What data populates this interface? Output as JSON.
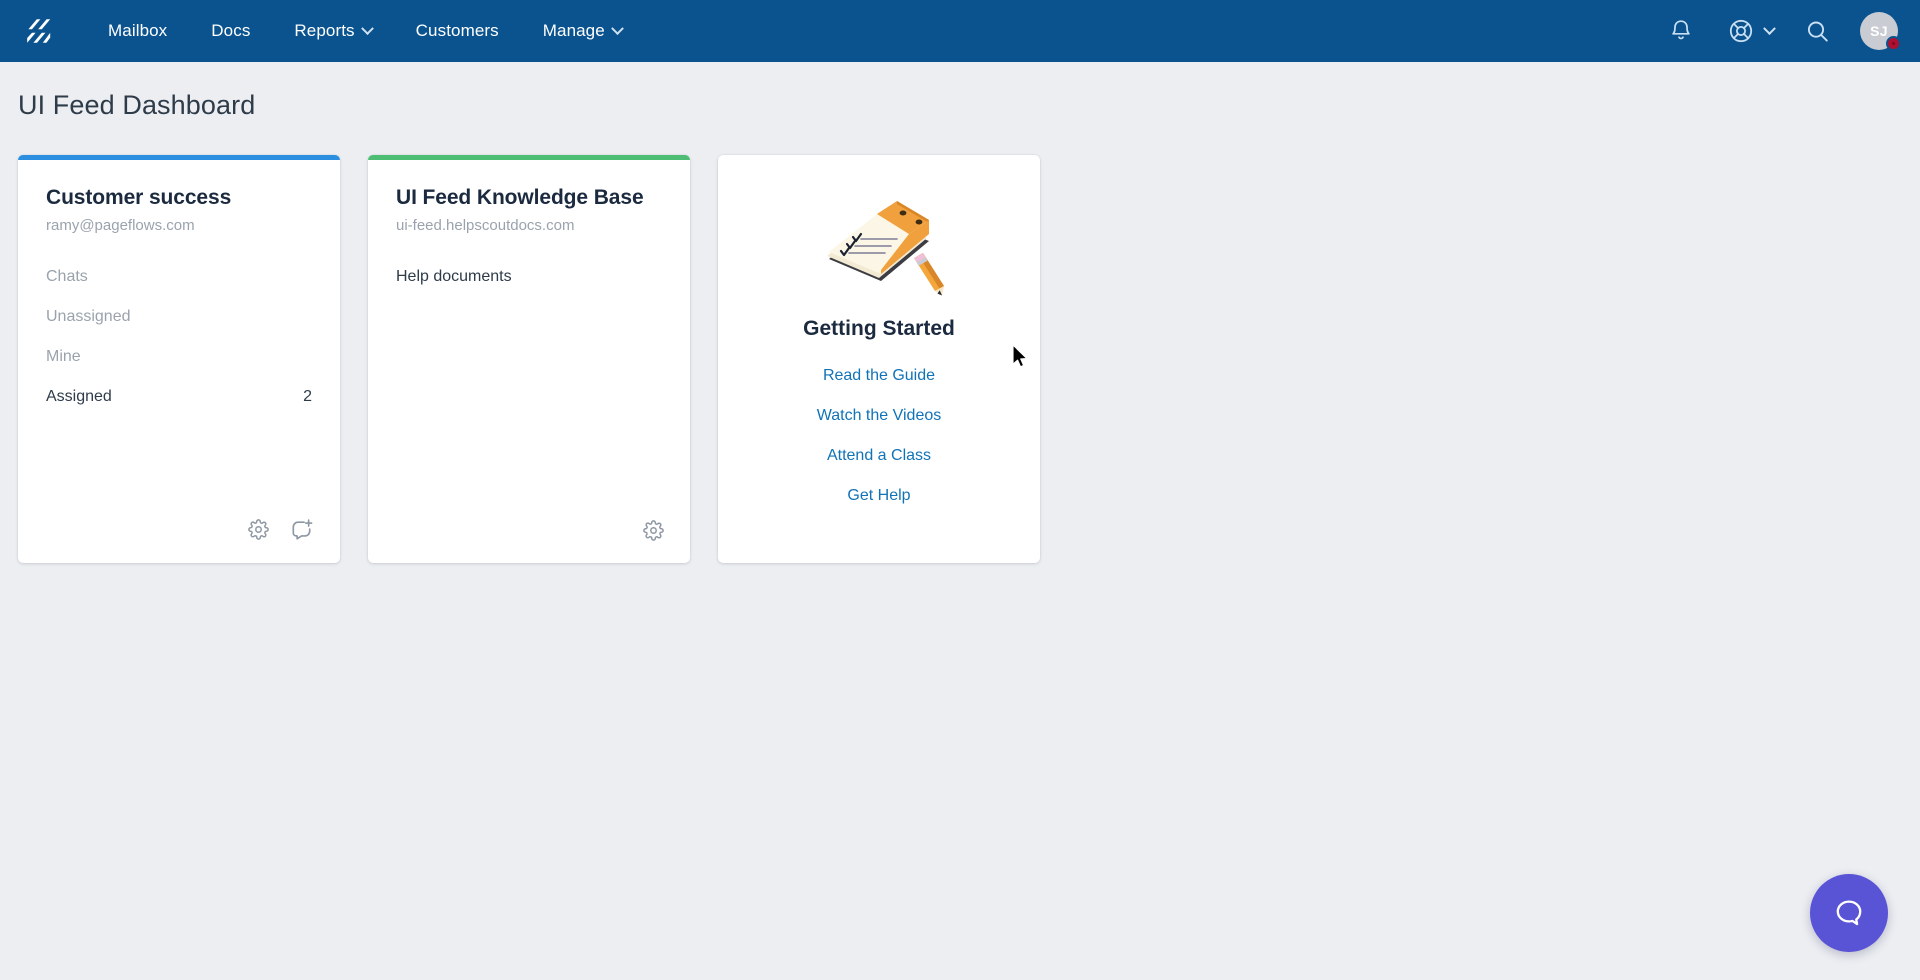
{
  "app": {
    "name": "Help Scout",
    "logo_icon": "helpscout-logo-icon",
    "nav_bg": "#0a538f",
    "page_bg": "#eceef2"
  },
  "navbar": {
    "links": [
      {
        "label": "Mailbox",
        "has_caret": false
      },
      {
        "label": "Docs",
        "has_caret": false
      },
      {
        "label": "Reports",
        "has_caret": true
      },
      {
        "label": "Customers",
        "has_caret": false
      },
      {
        "label": "Manage",
        "has_caret": true
      }
    ],
    "actions": {
      "notifications_icon": "bell-icon",
      "help_icon": "life-ring-icon",
      "help_has_caret": true,
      "search_icon": "search-icon",
      "avatar_initials": "SJ",
      "avatar_badge_color": "#b01030"
    }
  },
  "page": {
    "title": "UI Feed Dashboard"
  },
  "cards": {
    "mailbox": {
      "accent_color": "#2c8ee0",
      "title": "Customer success",
      "subtitle": "ramy@pageflows.com",
      "rows": [
        {
          "label": "Chats",
          "count": "",
          "state": "muted"
        },
        {
          "label": "Unassigned",
          "count": "",
          "state": "muted"
        },
        {
          "label": "Mine",
          "count": "",
          "state": "muted"
        },
        {
          "label": "Assigned",
          "count": "2",
          "state": "active"
        }
      ],
      "footer_icons": [
        {
          "name": "gear-icon"
        },
        {
          "name": "new-conversation-icon"
        }
      ]
    },
    "docs": {
      "accent_color": "#4dbd74",
      "title": "UI Feed Knowledge Base",
      "subtitle": "ui-feed.helpscoutdocs.com",
      "body_line": "Help documents",
      "footer_icons": [
        {
          "name": "gear-icon"
        }
      ]
    },
    "getting_started": {
      "illustration": "notepad-pencil-illustration",
      "title": "Getting Started",
      "links": [
        "Read the Guide",
        "Watch the Videos",
        "Attend a Class",
        "Get Help"
      ]
    }
  },
  "beacon": {
    "icon": "chat-bubble-icon",
    "color": "#5953d6"
  }
}
